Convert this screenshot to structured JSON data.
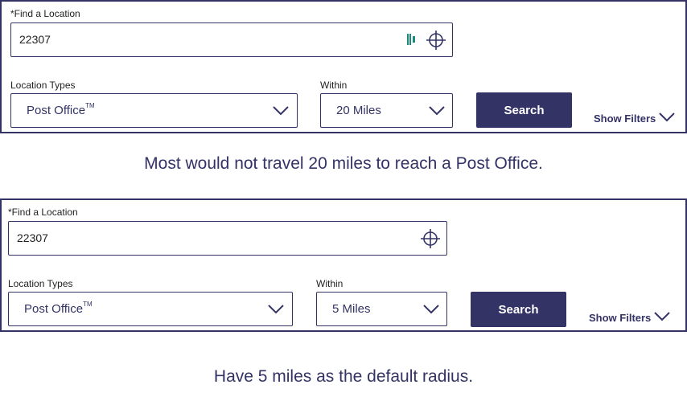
{
  "example1": {
    "find_label": "*Find a Location",
    "location_value": "22307",
    "location_types_label": "Location Types",
    "location_type_value": "Post Office",
    "trademark": "TM",
    "within_label": "Within",
    "within_value": "20 Miles",
    "search_label": "Search",
    "show_filters_label": "Show Filters",
    "caption": "Most would not travel 20 miles to reach a Post Office."
  },
  "example2": {
    "find_label": "*Find a Location",
    "location_value": "22307",
    "location_types_label": "Location Types",
    "location_type_value": "Post Office",
    "trademark": "TM",
    "within_label": "Within",
    "within_value": "5 Miles",
    "search_label": "Search",
    "show_filters_label": "Show Filters",
    "caption": "Have 5 miles as the default radius."
  },
  "colors": {
    "brand_navy": "#333366",
    "accent_teal": "#1a8a7a"
  },
  "icons": [
    "barcode-icon",
    "crosshair-icon",
    "chevron-down-icon"
  ]
}
